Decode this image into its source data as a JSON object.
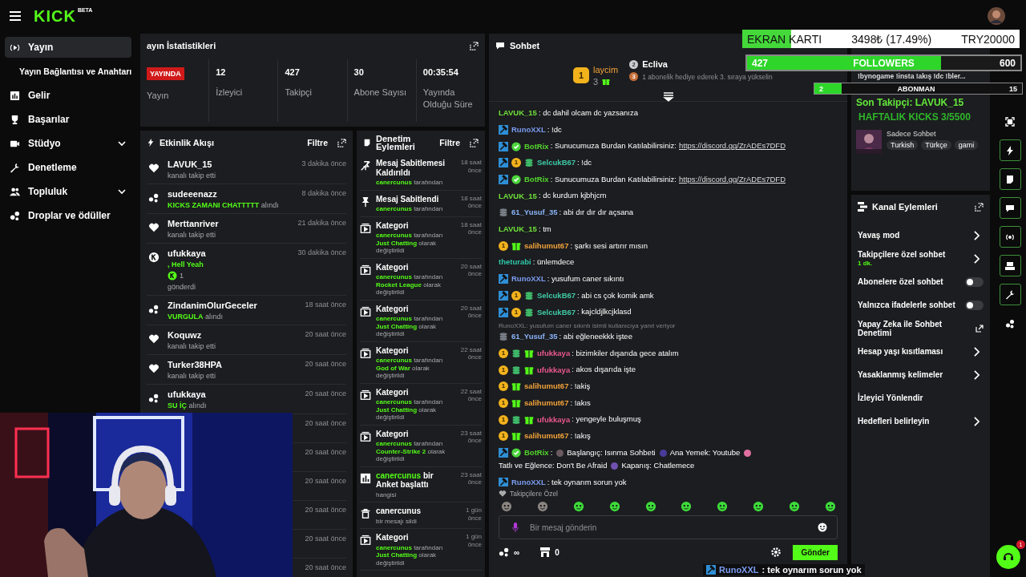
{
  "topbar": {
    "logo": "KICK",
    "logo_tag": "BETA"
  },
  "sidebar": [
    {
      "label": "Yayın",
      "kind": "live",
      "selected": true,
      "children": [
        {
          "label": "Yayın Bağlantısı ve Anahtarı",
          "selected": false
        }
      ]
    },
    {
      "label": "Gelir",
      "kind": "chart",
      "selected": false
    },
    {
      "label": "Başarılar",
      "kind": "trophy",
      "selected": false
    },
    {
      "label": "Stüdyo",
      "kind": "camera",
      "selected": false,
      "expanded": false
    },
    {
      "label": "Denetleme",
      "kind": "wrench",
      "selected": false
    },
    {
      "label": "Topluluk",
      "kind": "people",
      "selected": false,
      "expanded": false
    },
    {
      "label": "Droplar ve ödüller",
      "kind": "drops",
      "selected": false
    }
  ],
  "stats": {
    "title": "ayın İstatistikleri",
    "live": {
      "badge": "YAYINDA",
      "label": "Yayın"
    },
    "items": [
      {
        "value": "12",
        "label": "İzleyici"
      },
      {
        "value": "427",
        "label": "Takipçi"
      },
      {
        "value": "30",
        "label": "Abone Sayısı"
      },
      {
        "value": "00:35:54",
        "label": "Yayında Olduğu Süre"
      }
    ]
  },
  "activity": {
    "title": "Etkinlik Akışı",
    "filter": "Filtre",
    "items": [
      {
        "kind": "follow",
        "name": "LAVUK_15",
        "detail": "kanalı takip etti",
        "time": "3 dakika önce"
      },
      {
        "kind": "reward",
        "name": "sudeeenazz",
        "reward": "KICKS ZAMANI CHATTTTT",
        "detail": "alındı",
        "time": "8 dakika önce"
      },
      {
        "kind": "follow",
        "name": "Merttanriver",
        "detail": "kanalı takip etti",
        "time": "21 dakika önce"
      },
      {
        "kind": "kicks",
        "name": "ufukkaya",
        "message": ", Hell Yeah",
        "amount": "1",
        "detail": "gönderdi",
        "time": "30 dakika önce"
      },
      {
        "kind": "reward",
        "name": "ZindanimOlurGeceler",
        "reward": "VURGULA",
        "detail": "alındı",
        "time": "18 saat önce"
      },
      {
        "kind": "follow",
        "name": "Koquwz",
        "detail": "kanalı takip etti",
        "time": "20 saat önce"
      },
      {
        "kind": "follow",
        "name": "Turker38HPA",
        "detail": "kanalı takip etti",
        "time": "20 saat önce"
      },
      {
        "kind": "reward",
        "name": "ufukkaya",
        "reward": "SU İÇ",
        "detail": "alındı",
        "time": "20 saat önce"
      },
      {
        "kind": "covered",
        "time": "20 saat önce"
      },
      {
        "kind": "covered",
        "time": "20 saat önce"
      },
      {
        "kind": "covered",
        "time": "20 saat önce"
      },
      {
        "kind": "covered",
        "time": "20 saat önce"
      },
      {
        "kind": "covered",
        "time": "20 saat önce"
      },
      {
        "kind": "covered",
        "time": "20 saat önce"
      }
    ]
  },
  "moderation": {
    "title": "Denetim Eylemleri",
    "filter": "Filtre",
    "items": [
      {
        "kind": "unpin",
        "title": "Mesaj Sabitlemesi Kaldırıldı",
        "time": "18 saat önce",
        "detail": "**canercunus** tarafından"
      },
      {
        "kind": "pin",
        "title": "Mesaj Sabitlendi",
        "time": "18 saat önce",
        "detail": "**canercunus** tarafından"
      },
      {
        "kind": "category",
        "title": "Kategori",
        "time": "18 saat önce",
        "detail": "**canercunus** tarafından **Just Chatting** olarak değiştirildi"
      },
      {
        "kind": "category",
        "title": "Kategori",
        "time": "20 saat önce",
        "detail": "**canercunus** tarafından **Rocket League** olarak değiştirildi"
      },
      {
        "kind": "category",
        "title": "Kategori",
        "time": "20 saat önce",
        "detail": "**canercunus** tarafından **Just Chatting** olarak değiştirildi"
      },
      {
        "kind": "category",
        "title": "Kategori",
        "time": "22 saat önce",
        "detail": "**canercunus** tarafından **God of War** olarak değiştirildi"
      },
      {
        "kind": "category",
        "title": "Kategori",
        "time": "22 saat önce",
        "detail": "**canercunus** tarafından **Just Chatting** olarak değiştirildi"
      },
      {
        "kind": "category",
        "title": "Kategori",
        "time": "23 saat önce",
        "detail": "**canercunus** tarafından **Counter-Strike 2** olarak değiştirildi"
      },
      {
        "kind": "poll",
        "title": "**canercunus** bir Anket başlattı",
        "time": "23 saat önce",
        "detail": "hangisi"
      },
      {
        "kind": "delete",
        "title": "canercunus",
        "time": "1 gün önce",
        "detail": "bir mesajı sildi"
      },
      {
        "kind": "category",
        "title": "Kategori",
        "time": "1 gün önce",
        "detail": "**canercunus** tarafından **Just Chatting** olarak değiştirildi"
      }
    ]
  },
  "chat": {
    "title": "Sohbet",
    "leaders": [
      {
        "rank": "1",
        "name": "laycim",
        "count": "3"
      },
      {
        "rank": "2",
        "name": "Ecliva"
      },
      {
        "rank": "3",
        "name": "1 abonelik hediye ederek 3. sıraya yükselin"
      }
    ],
    "messages": [
      {
        "user": "LAVUK_15",
        "color": "#6fe03a",
        "text": ": dc dahil olcam dc yazsanıza"
      },
      {
        "badges": [
          {
            "kind": "mod"
          }
        ],
        "user": "RunoXXL",
        "color": "#7b9cf0",
        "text": ": !dc"
      },
      {
        "badges": [
          {
            "kind": "mod"
          },
          {
            "kind": "verified"
          }
        ],
        "user": "BotRix",
        "color": "#53d62e",
        "text": ": Sunucumuza Burdan Katılabilirsiniz:",
        "link": "https://discord.gg/ZrADEs7DFD"
      },
      {
        "badges": [
          {
            "kind": "mod"
          },
          {
            "kind": "sub",
            "label": "1"
          },
          {
            "kind": "dollar"
          }
        ],
        "user": "SelcukB67",
        "color": "#3ec9a6",
        "text": ": !dc"
      },
      {
        "badges": [
          {
            "kind": "mod"
          },
          {
            "kind": "verified"
          }
        ],
        "user": "BotRix",
        "color": "#53d62e",
        "text": ": Sunucumuza Burdan Katılabilirsiniz:",
        "link": "https://discord.gg/ZrADEs7DFD"
      },
      {
        "user": "LAVUK_15",
        "color": "#6fe03a",
        "text": ": dc kurdum kjbhjcm"
      },
      {
        "badges": [
          {
            "kind": "dollar-grey"
          }
        ],
        "user": "61_Yusuf_35",
        "color": "#8ab4f8",
        "text": ": abi dır dır dır açsana"
      },
      {
        "user": "LAVUK_15",
        "color": "#6fe03a",
        "text": ": tm"
      },
      {
        "badges": [
          {
            "kind": "sub",
            "label": "1"
          },
          {
            "kind": "gift"
          }
        ],
        "user": "salihumut67",
        "color": "#f2a33a",
        "text": ": şarkı sesi artırır mısın"
      },
      {
        "user": "theturabi",
        "color": "#2fc6a8",
        "text": ": ünlemdece"
      },
      {
        "badges": [
          {
            "kind": "mod"
          }
        ],
        "user": "RunoXXL",
        "color": "#7b9cf0",
        "text": ": yusufum caner sıkıntı"
      },
      {
        "badges": [
          {
            "kind": "mod"
          },
          {
            "kind": "sub",
            "label": "1"
          },
          {
            "kind": "dollar"
          }
        ],
        "user": "SelcukB67",
        "color": "#3ec9a6",
        "text": ": abi cs çok komik amk"
      },
      {
        "badges": [
          {
            "kind": "mod"
          },
          {
            "kind": "sub",
            "label": "1"
          },
          {
            "kind": "dollar"
          }
        ],
        "user": "SelcukB67",
        "color": "#3ec9a6",
        "text": ": kajcldjlkcjklasd"
      },
      {
        "reply": "RunoXXL: yusufum caner sıkıntı isimli kullanıcıya yanıt veriyor",
        "badges": [
          {
            "kind": "dollar-grey"
          }
        ],
        "user": "61_Yusuf_35",
        "color": "#8ab4f8",
        "text": ": abi eğleneekkk iştee"
      },
      {
        "badges": [
          {
            "kind": "sub",
            "label": "1"
          },
          {
            "kind": "dollar"
          },
          {
            "kind": "gift"
          }
        ],
        "user": "ufukkaya",
        "color": "#e8588a",
        "text": ": bizimkiler dışarıda gece atalım"
      },
      {
        "badges": [
          {
            "kind": "sub",
            "label": "1"
          },
          {
            "kind": "dollar"
          },
          {
            "kind": "gift"
          }
        ],
        "user": "ufukkaya",
        "color": "#e8588a",
        "text": ": akos dışarıda işte"
      },
      {
        "badges": [
          {
            "kind": "sub",
            "label": "1"
          },
          {
            "kind": "gift"
          }
        ],
        "user": "salihumut67",
        "color": "#f2a33a",
        "text": ": !akiş"
      },
      {
        "badges": [
          {
            "kind": "sub",
            "label": "1"
          },
          {
            "kind": "gift"
          }
        ],
        "user": "salihumut67",
        "color": "#f2a33a",
        "text": ": !akıs"
      },
      {
        "badges": [
          {
            "kind": "sub",
            "label": "1"
          },
          {
            "kind": "dollar"
          },
          {
            "kind": "gift"
          }
        ],
        "user": "ufukkaya",
        "color": "#e8588a",
        "text": ": yengeyle buluşmuş"
      },
      {
        "badges": [
          {
            "kind": "sub",
            "label": "1"
          },
          {
            "kind": "gift"
          }
        ],
        "user": "salihumut67",
        "color": "#f2a33a",
        "text": ": !akış"
      },
      {
        "badges": [
          {
            "kind": "mod"
          },
          {
            "kind": "verified"
          }
        ],
        "user": "BotRix",
        "color": "#53d62e",
        "text": ":",
        "segments": [
          "Başlangıç: Isınma Sohbeti",
          "Ana Yemek: Youtube",
          "Tatlı ve Eğlence: Don't Be Afraid",
          "Kapanış: Chatlemece"
        ]
      },
      {
        "badges": [
          {
            "kind": "mod"
          }
        ],
        "user": "RunoXXL",
        "color": "#7b9cf0",
        "text": ": tek oynarım sorun yok"
      }
    ],
    "emote_label": "Takipçilere Özel",
    "placeholder": "Bir mesaj gönderin",
    "points": "∞",
    "count": "0",
    "send": "Gönder"
  },
  "stream_info": {
    "description": "!bynogame !insta !akış !dc !bler...",
    "category": "Sadece Sohbet",
    "tags": [
      "Turkish",
      "Türkçe",
      "gami"
    ]
  },
  "channel_actions": {
    "title": "Kanal Eylemleri",
    "items": [
      {
        "kind": "arrow",
        "label": "Yavaş mod"
      },
      {
        "kind": "arrow",
        "label": "Takipçilere özel sohbet",
        "value": "1 dk."
      },
      {
        "kind": "toggle",
        "label": "Abonelere özel sohbet",
        "on": false
      },
      {
        "kind": "toggle",
        "label": "Yalnızca ifadelerle sohbet",
        "on": false
      },
      {
        "kind": "external",
        "label": "Yapay Zeka ile Sohbet Denetimi"
      },
      {
        "kind": "arrow",
        "label": "Hesap yaşı kısıtlaması"
      },
      {
        "kind": "arrow",
        "label": "Yasaklanmış kelimeler"
      },
      {
        "kind": "plain",
        "label": "İzleyici Yönlendir"
      },
      {
        "kind": "arrow",
        "label": "Hedefleri belirleyin"
      }
    ]
  },
  "rail": [
    {
      "kind": "scan",
      "pinned": false
    },
    {
      "kind": "bolt",
      "pinned": true
    },
    {
      "kind": "note",
      "pinned": true
    },
    {
      "kind": "chat",
      "pinned": true
    },
    {
      "kind": "broadcast",
      "pinned": true
    },
    {
      "kind": "camera",
      "pinned": true
    },
    {
      "kind": "wrench",
      "pinned": true
    },
    {
      "kind": "dots",
      "pinned": false
    }
  ],
  "help_badge": "1",
  "overlays": {
    "goal": {
      "label": "EKRAN KARTI",
      "amount": "3498₺ (17.49%)",
      "target": "TRY20000",
      "level": 0.1749
    },
    "followers": {
      "current": "427",
      "label": "FOLLOWERS",
      "target": "600",
      "level": 0.71
    },
    "subs": {
      "current": "2",
      "label": "ABONMAN",
      "target": "15",
      "level": 0.13
    },
    "last_follower": "Son Takipçi: LAVUK_15",
    "weekly": "HAFTALIK KICKS 3/5500",
    "chat_user": "RunoXXL",
    "chat_text": ": tek oynarım sorun yok"
  }
}
